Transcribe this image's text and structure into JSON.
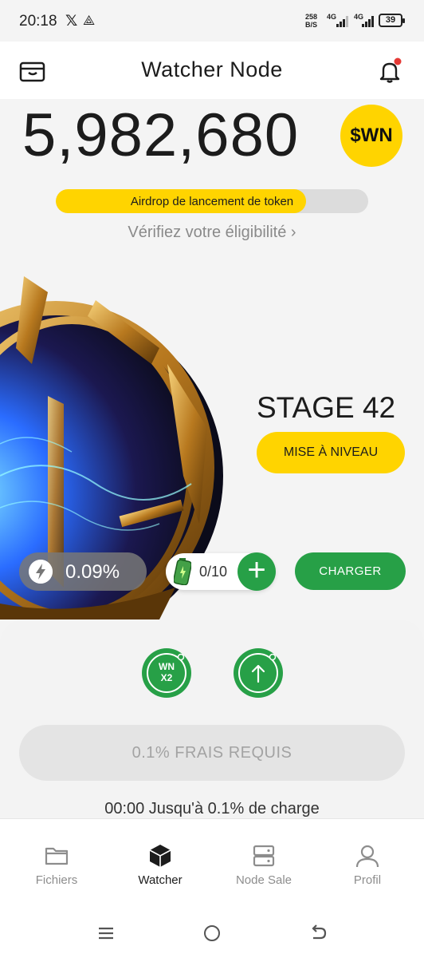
{
  "status_bar": {
    "time": "20:18",
    "x_icon": "x-logo",
    "app_icon": "app-notification-icon",
    "net_speed": "258",
    "net_unit": "B/S",
    "sig1": "4G",
    "sig2": "4G",
    "battery": "39"
  },
  "header": {
    "title": "Watcher Node",
    "left_icon": "wallet-icon",
    "right_icon": "bell-icon",
    "notification_dot_color": "#e53935"
  },
  "balance": {
    "amount": "5,982,680",
    "token_badge": "$WN"
  },
  "airdrop": {
    "label": "Airdrop de lancement de token",
    "progress": 0.8,
    "verify_link": "Vérifiez votre éligibilité ›"
  },
  "stage": {
    "label": "STAGE 42",
    "upgrade_button": "MISE À NIVEAU"
  },
  "controls": {
    "speed_value": "0.09%",
    "energy_value": "0/10",
    "add_button": "+",
    "charger_button": "CHARGER"
  },
  "panel": {
    "boost_button": "WN X2",
    "boost_line1": "WN",
    "boost_line2": "X2",
    "fees_button": "0.1% FRAIS REQUIS",
    "timer_text": "00:00 Jusqu'à 0.1% de charge"
  },
  "nav": {
    "items": [
      {
        "label": "Fichiers",
        "icon": "folder-icon"
      },
      {
        "label": "Watcher",
        "icon": "cube-icon",
        "active": true
      },
      {
        "label": "Node Sale",
        "icon": "server-icon"
      },
      {
        "label": "Profil",
        "icon": "user-icon"
      }
    ]
  },
  "colors": {
    "accent_yellow": "#ffd400",
    "accent_green": "#27a047",
    "background": "#f4f4f4"
  }
}
